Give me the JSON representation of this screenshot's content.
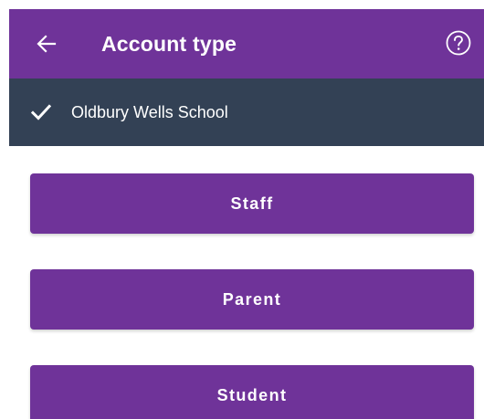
{
  "appbar": {
    "title": "Account type",
    "back_icon": "arrow-left-icon",
    "help_icon": "help-circle-icon",
    "background": "#6f3399"
  },
  "school": {
    "name": "Oldbury Wells School",
    "status_icon": "check-icon",
    "background": "#334155"
  },
  "account_types": {
    "staff_label": "Staff",
    "parent_label": "Parent",
    "student_label": "Student",
    "button_color": "#6f3399"
  }
}
